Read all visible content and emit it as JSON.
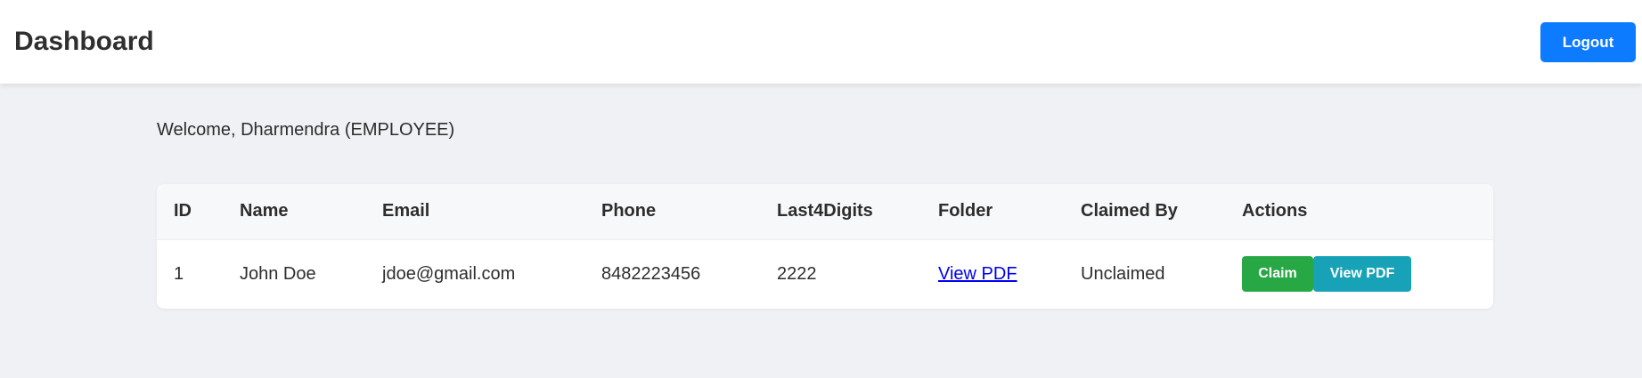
{
  "header": {
    "title": "Dashboard",
    "logout_label": "Logout"
  },
  "welcome_text": "Welcome, Dharmendra (EMPLOYEE)",
  "table": {
    "columns": [
      "ID",
      "Name",
      "Email",
      "Phone",
      "Last4Digits",
      "Folder",
      "Claimed By",
      "Actions"
    ],
    "rows": [
      {
        "id": "1",
        "name": "John Doe",
        "email": "jdoe@gmail.com",
        "phone": "8482223456",
        "last4": "2222",
        "folder_link": "View PDF",
        "claimed_by": "Unclaimed",
        "actions": {
          "claim_label": "Claim",
          "view_pdf_label": "View PDF"
        }
      }
    ]
  },
  "colors": {
    "primary": "#0d7bff",
    "success": "#28a745",
    "info": "#17a2b8",
    "background": "#f0f1f4",
    "link": "#0000ee"
  }
}
